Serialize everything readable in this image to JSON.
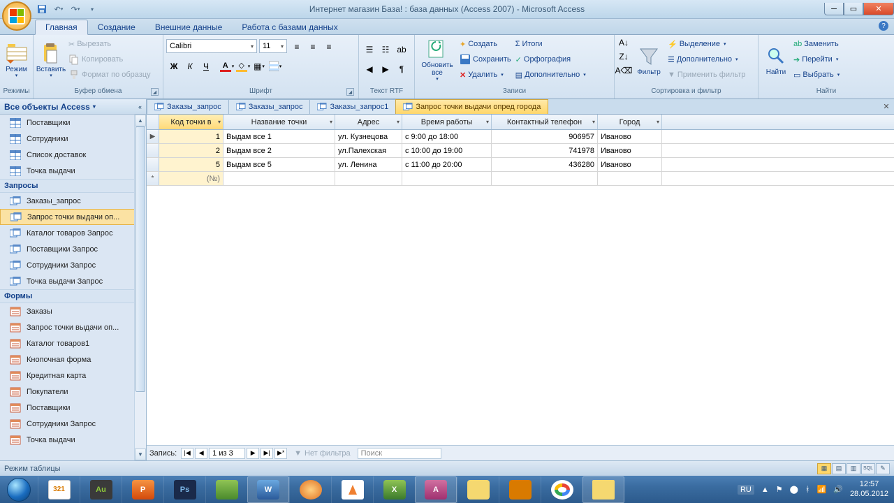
{
  "title": "Интернет магазин База! : база данных (Access 2007) - Microsoft Access",
  "ribbon_tabs": [
    "Главная",
    "Создание",
    "Внешние данные",
    "Работа с базами данных"
  ],
  "ribbon": {
    "groups": {
      "views": "Режимы",
      "clipboard": "Буфер обмена",
      "font": "Шрифт",
      "richtext": "Текст RTF",
      "records": "Записи",
      "sortfilter": "Сортировка и фильтр",
      "find": "Найти"
    },
    "view_btn": "Режим",
    "paste_btn": "Вставить",
    "cut": "Вырезать",
    "copy": "Копировать",
    "fmtpainter": "Формат по образцу",
    "font_name": "Calibri",
    "font_size": "11",
    "refresh": "Обновить все",
    "create": "Создать",
    "save": "Сохранить",
    "delete": "Удалить",
    "totals": "Итоги",
    "spelling": "Орфография",
    "more": "Дополнительно",
    "filter": "Фильтр",
    "selection": "Выделение",
    "advanced": "Дополнительно",
    "togglefilter": "Применить фильтр",
    "find_btn": "Найти",
    "replace": "Заменить",
    "goto": "Перейти",
    "select": "Выбрать"
  },
  "navpane": {
    "title": "Все объекты Access",
    "tables": [
      "Поставщики",
      "Сотрудники",
      "Список доставок",
      "Точка выдачи"
    ],
    "section_queries": "Запросы",
    "queries": [
      "Заказы_запрос",
      "Запрос точки выдачи оп...",
      "Каталог товаров Запрос",
      "Поставщики Запрос",
      "Сотрудники Запрос",
      "Точка выдачи Запрос"
    ],
    "section_forms": "Формы",
    "forms": [
      "Заказы",
      "Запрос точки выдачи оп...",
      "Каталог товаров1",
      "Кнопочная форма",
      "Кредитная карта",
      "Покупатели",
      "Поставщики",
      "Сотрудники Запрос",
      "Точка выдачи"
    ]
  },
  "doc_tabs": [
    "Заказы_запрос",
    "Заказы_запрос",
    "Заказы_запрос1",
    "Запрос точки выдачи опред города"
  ],
  "datasheet": {
    "columns": [
      "Код точки в",
      "Название точки",
      "Адрес",
      "Время работы",
      "Контактный телефон",
      "Город"
    ],
    "rows": [
      {
        "code": "1",
        "name": "Выдам все 1",
        "addr": "ул. Кузнецова",
        "hours": "с 9:00 до 18:00",
        "phone": "906957",
        "city": "Иваново"
      },
      {
        "code": "2",
        "name": "Выдам все 2",
        "addr": "ул.Палехская",
        "hours": "с 10:00 до 19:00",
        "phone": "741978",
        "city": "Иваново"
      },
      {
        "code": "5",
        "name": "Выдам все 5",
        "addr": "ул. Ленина",
        "hours": "с 11:00 до 20:00",
        "phone": "436280",
        "city": "Иваново"
      }
    ],
    "newrow_placeholder": "(№)"
  },
  "recnav": {
    "label": "Запись:",
    "pos": "1 из 3",
    "nofilter": "Нет фильтра",
    "search": "Поиск"
  },
  "status": "Режим таблицы",
  "tray": {
    "lang": "RU",
    "time": "12:57",
    "date": "28.05.2012"
  }
}
